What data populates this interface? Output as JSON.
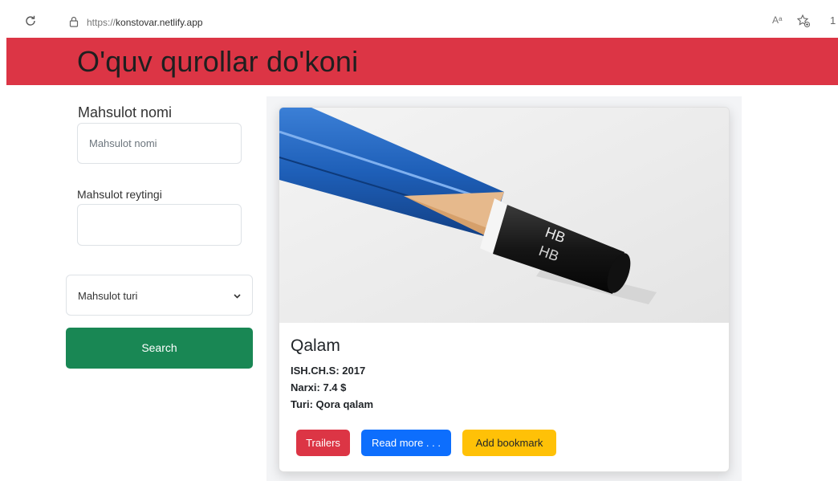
{
  "browser": {
    "url_protocol": "https://",
    "url_host": "konstovar.netlify.app",
    "read_aloud_label": "Aᵃ",
    "edge_cut_text": "1"
  },
  "header": {
    "title": "O'quv qurollar do'koni",
    "bg_color": "#dc3545"
  },
  "form": {
    "name_label": "Mahsulot nomi",
    "name_placeholder": "Mahsulot nomi",
    "rating_label": "Mahsulot reytingi",
    "rating_value": "",
    "type_select_value": "Mahsulot turi",
    "search_label": "Search",
    "search_color": "#198754"
  },
  "product": {
    "name": "Qalam",
    "year": "ISH.CH.S: 2017",
    "price": "Narxi: 7.4 $",
    "type": "Turi: Qora qalam",
    "image_icon": "pencil-image",
    "image_text": "HB",
    "buttons": {
      "trailers": "Trailers",
      "read_more": "Read more . . .",
      "bookmark": "Add bookmark"
    }
  }
}
